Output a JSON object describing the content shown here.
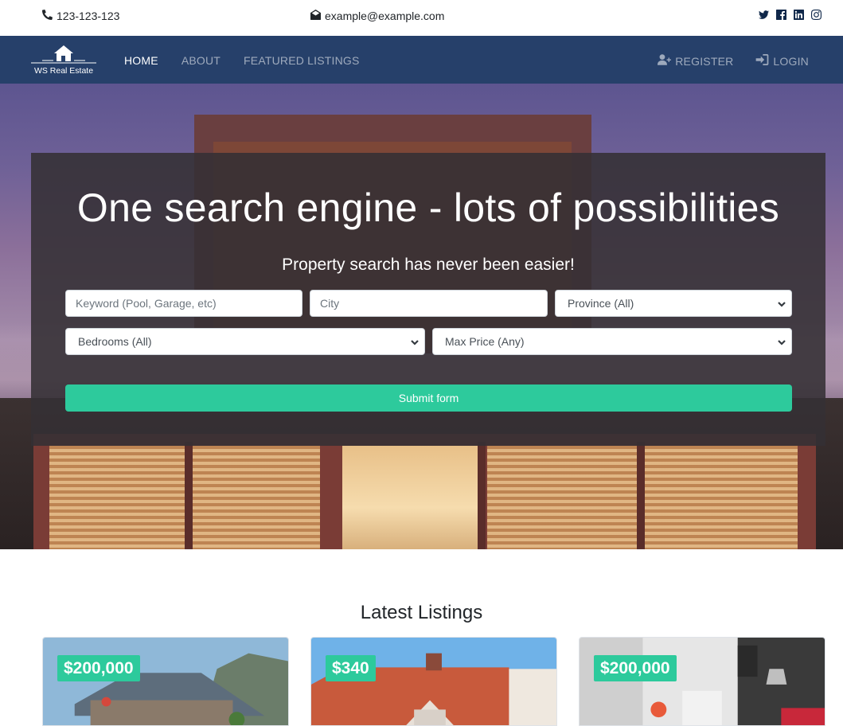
{
  "topbar": {
    "phone": "123-123-123",
    "email": "example@example.com",
    "social": [
      "twitter-icon",
      "facebook-icon",
      "linkedin-icon",
      "instagram-icon"
    ]
  },
  "brand": {
    "name": "WS Real Estate"
  },
  "nav": {
    "left": [
      {
        "label": "HOME",
        "active": true
      },
      {
        "label": "ABOUT",
        "active": false
      },
      {
        "label": "FEATURED LISTINGS",
        "active": false
      }
    ],
    "right": [
      {
        "label": "REGISTER",
        "icon": "user-plus-icon"
      },
      {
        "label": "LOGIN",
        "icon": "sign-in-icon"
      }
    ]
  },
  "hero": {
    "title": "One search engine - lots of possibilities",
    "subtitle": "Property search has never been easier!"
  },
  "search": {
    "keyword_placeholder": "Keyword (Pool, Garage, etc)",
    "city_placeholder": "City",
    "province_selected": "Province (All)",
    "bedrooms_selected": "Bedrooms (All)",
    "max_price_selected": "Max Price (Any)",
    "submit_label": "Submit form"
  },
  "listings": {
    "title": "Latest Listings",
    "items": [
      {
        "price": "$200,000"
      },
      {
        "price": "$340"
      },
      {
        "price": "$200,000"
      }
    ]
  },
  "colors": {
    "navbar": "#26406a",
    "accent": "#2dca9c",
    "panel": "#343034"
  }
}
